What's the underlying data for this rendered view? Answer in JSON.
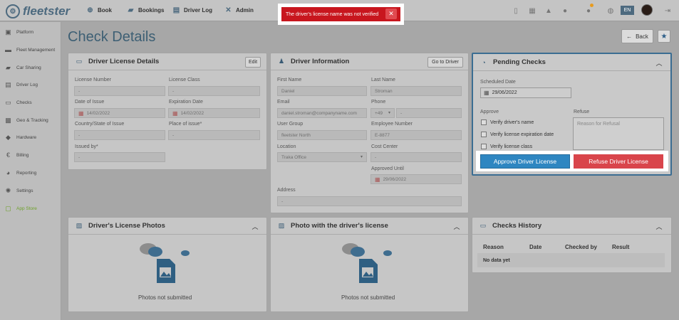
{
  "app": {
    "logo_text": "fleetster",
    "lang": "EN"
  },
  "nav": {
    "book": "Book",
    "bookings": "Bookings",
    "driver_log": "Driver Log",
    "admin": "Admin"
  },
  "toast": {
    "message": "The driver's license name was not verified",
    "close": "✕"
  },
  "sidebar": {
    "items": [
      {
        "label": "Platform"
      },
      {
        "label": "Fleet Management"
      },
      {
        "label": "Car Sharing"
      },
      {
        "label": "Driver Log"
      },
      {
        "label": "Checks"
      },
      {
        "label": "Geo & Tracking"
      },
      {
        "label": "Hardware"
      },
      {
        "label": "Billing"
      },
      {
        "label": "Reporting"
      },
      {
        "label": "Settings"
      },
      {
        "label": "App Store"
      }
    ]
  },
  "page": {
    "title": "Check Details",
    "back_label": "Back"
  },
  "license_details": {
    "title": "Driver License Details",
    "edit_label": "Edit",
    "license_number_label": "License Number",
    "license_number_value": "-",
    "license_class_label": "License Class",
    "license_class_value": "-",
    "date_of_issue_label": "Date of Issue",
    "date_of_issue_value": "14/02/2022",
    "expiration_date_label": "Expiration Date",
    "expiration_date_value": "14/02/2022",
    "country_label": "Country/State of Issue",
    "country_value": "-",
    "place_label": "Place of issue*",
    "place_value": "-",
    "issued_by_label": "Issued by*",
    "issued_by_value": "-"
  },
  "driver_info": {
    "title": "Driver Information",
    "goto_label": "Go to Driver",
    "first_name_label": "First Name",
    "first_name_value": "Daniel",
    "last_name_label": "Last Name",
    "last_name_value": "Stroman",
    "email_label": "Email",
    "email_value": "daniel.stroman@companyname.com",
    "phone_label": "Phone",
    "phone_prefix": "+49",
    "phone_value": "-",
    "user_group_label": "User Group",
    "user_group_value": "fleetster North",
    "employee_number_label": "Employee Number",
    "employee_number_value": "E-8877",
    "location_label": "Location",
    "location_value": "Traka Office",
    "cost_center_label": "Cost Center",
    "cost_center_value": "-",
    "approved_until_label": "Approved Until",
    "approved_until_value": "29/06/2022",
    "address_label": "Address",
    "address_value": "-"
  },
  "pending": {
    "title": "Pending Checks",
    "scheduled_label": "Scheduled Date",
    "scheduled_value": "29/06/2022",
    "approve_label": "Approve",
    "refuse_label": "Refuse",
    "checks": [
      {
        "label": "Verify driver's name"
      },
      {
        "label": "Verify license expiration date"
      },
      {
        "label": "Verify license class"
      }
    ],
    "refuse_placeholder": "Reason for Refusal",
    "approve_button": "Approve Driver License",
    "refuse_button": "Refuse Driver License"
  },
  "photos": {
    "license_title": "Driver's License Photos",
    "with_license_title": "Photo with the driver's license",
    "empty": "Photos not submitted"
  },
  "history": {
    "title": "Checks History",
    "columns": [
      "Reason",
      "Date",
      "Checked by",
      "Result"
    ],
    "empty": "No data yet"
  },
  "colors": {
    "brand": "#4d6a7f",
    "title": "#3d5f74",
    "approve": "#2e86c1",
    "refuse": "#d9454b",
    "toast": "#c8161e",
    "app_store": "#6ea12a"
  }
}
